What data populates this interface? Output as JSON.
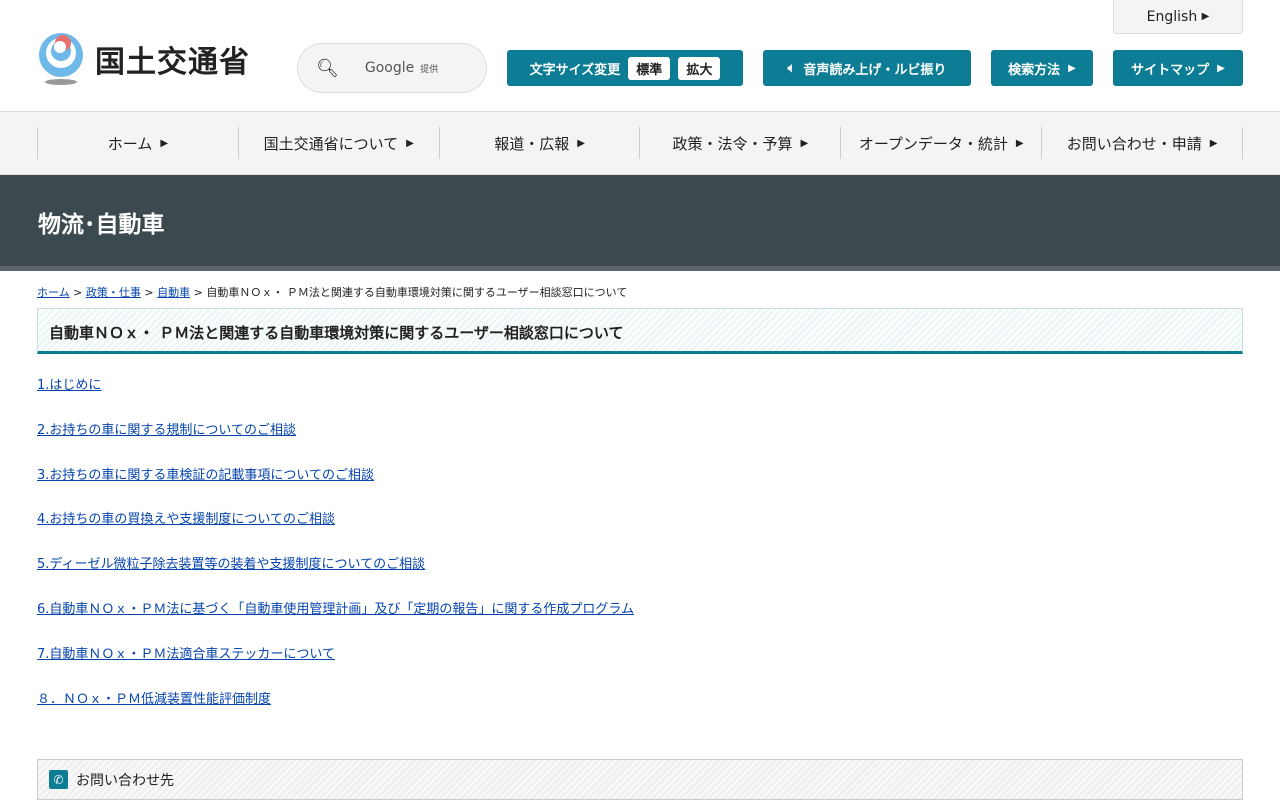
{
  "header": {
    "logo_text": "国土交通省",
    "english": "English",
    "search_brand": "Google",
    "search_suffix": "提供",
    "font_size_label": "文字サイズ変更",
    "font_standard": "標準",
    "font_large": "拡大",
    "speech": "音声読み上げ・ルビ振り",
    "search_method": "検索方法",
    "sitemap": "サイトマップ"
  },
  "nav": [
    "ホーム",
    "国土交通省について",
    "報道・広報",
    "政策・法令・予算",
    "オープンデータ・統計",
    "お問い合わせ・申請"
  ],
  "banner": "物流･自動車",
  "breadcrumb": {
    "items": [
      "ホーム",
      "政策・仕事",
      "自動車"
    ],
    "current": "自動車ＮＯｘ・ ＰＭ法と関連する自動車環境対策に関するユーザー相談窓口について"
  },
  "title": "自動車ＮＯｘ・ ＰＭ法と関連する自動車環境対策に関するユーザー相談窓口について",
  "links": [
    "1.はじめに",
    "2.お持ちの車に関する規制についてのご相談",
    "3.お持ちの車に関する車検証の記載事項についてのご相談",
    "4.お持ちの車の買換えや支援制度についてのご相談",
    "5.ディーゼル微粒子除去装置等の装着や支援制度についてのご相談",
    "6.自動車ＮＯｘ・ＰＭ法に基づく「自動車使用管理計画」及び「定期の報告」に関する作成プログラム",
    "7.自動車ＮＯｘ・ＰＭ法適合車ステッカーについて",
    "８．ＮＯｘ・ＰＭ低減装置性能評価制度"
  ],
  "contact": "お問い合わせ先"
}
